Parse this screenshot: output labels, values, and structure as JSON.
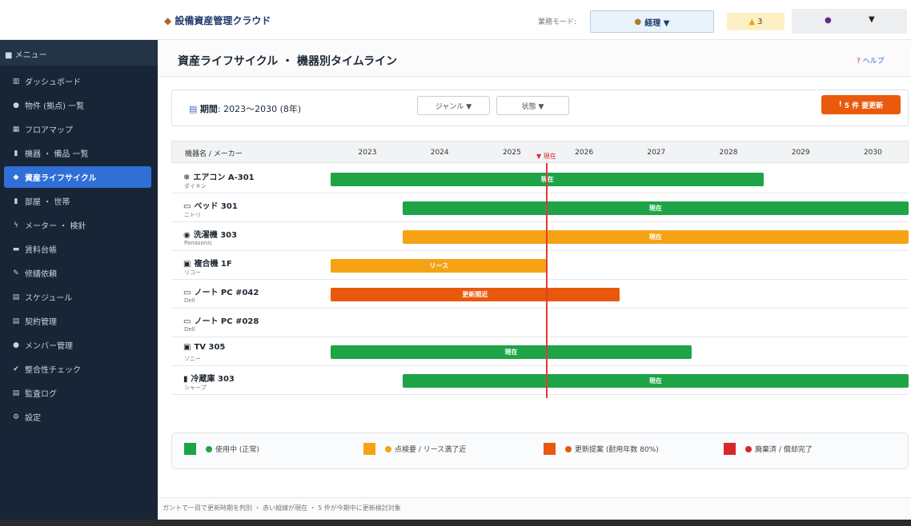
{
  "app": {
    "title": "設備資産管理クラウド",
    "title_icon": "box-icon",
    "mode_label": "業務モード:",
    "mode_value": "経理 ▼",
    "notification_count": "3",
    "user_caret": "▼"
  },
  "sidebar": {
    "header": "メニュー",
    "items": [
      {
        "label": "ダッシュボード",
        "icon": "chart-icon",
        "glyph": "▥"
      },
      {
        "label": "物件 (拠点) 一覧",
        "icon": "pin-icon",
        "glyph": "●"
      },
      {
        "label": "フロアマップ",
        "icon": "map-icon",
        "glyph": "▦"
      },
      {
        "label": "機器 ・ 備品 一覧",
        "icon": "device-icon",
        "glyph": "▮"
      },
      {
        "label": "資産ライフサイクル",
        "icon": "box-icon",
        "glyph": "◆",
        "active": true
      },
      {
        "label": "部屋 ・ 世帯",
        "icon": "door-icon",
        "glyph": "▮"
      },
      {
        "label": "メーター ・ 検針",
        "icon": "bolt-icon",
        "glyph": "ϟ"
      },
      {
        "label": "賃料台帳",
        "icon": "money-icon",
        "glyph": "▬"
      },
      {
        "label": "修繕依頼",
        "icon": "wrench-icon",
        "glyph": "✎"
      },
      {
        "label": "スケジュール",
        "icon": "calendar-icon",
        "glyph": "▤"
      },
      {
        "label": "契約管理",
        "icon": "document-icon",
        "glyph": "▤"
      },
      {
        "label": "メンバー管理",
        "icon": "people-icon",
        "glyph": "●"
      },
      {
        "label": "整合性チェック",
        "icon": "check-icon",
        "glyph": "✔"
      },
      {
        "label": "監査ログ",
        "icon": "clipboard-icon",
        "glyph": "▤"
      },
      {
        "label": "設定",
        "icon": "gear-icon",
        "glyph": "⚙"
      }
    ]
  },
  "page": {
    "title": "資産ライフサイクル ・ 機器別タイムライン",
    "help": "ヘルプ"
  },
  "filters": {
    "period_label": "期間",
    "period_value": ": 2023〜2030 (8年)",
    "genre": "ジャンル ▼",
    "status": "状態 ▼",
    "update_button": "5 件 要更新"
  },
  "colors": {
    "active": "#1ea446",
    "inspection": "#f5a314",
    "replace": "#e8590c",
    "disposed": "#d62828"
  },
  "chart_data": {
    "type": "gantt",
    "col_header": "機器名 / メーカー",
    "years": [
      "2023",
      "2024",
      "2025",
      "2026",
      "2027",
      "2028",
      "2029",
      "2030"
    ],
    "now_label": "▼ 現在",
    "now_year": 2025.5,
    "rows": [
      {
        "name": "エアコン A-301",
        "icon": "snowflake-icon",
        "glyph": "❄",
        "maker": "ダイキン",
        "bar": {
          "start": 2023,
          "end": 2029,
          "label": "現在",
          "status": "active"
        }
      },
      {
        "name": "ベッド 301",
        "icon": "bed-icon",
        "glyph": "▭",
        "maker": "ニトリ",
        "bar": {
          "start": 2024,
          "end": 2031,
          "label": "現在",
          "status": "active"
        }
      },
      {
        "name": "洗濯機 303",
        "icon": "washer-icon",
        "glyph": "◉",
        "maker": "Panasonic",
        "bar": {
          "start": 2024,
          "end": 2031,
          "label": "現在",
          "status": "inspection"
        }
      },
      {
        "name": "複合機 1F",
        "icon": "printer-icon",
        "glyph": "▣",
        "maker": "リコー",
        "bar": {
          "start": 2023,
          "end": 2026,
          "label": "リース",
          "status": "inspection"
        }
      },
      {
        "name": "ノート PC #042",
        "icon": "laptop-icon",
        "glyph": "▭",
        "maker": "Dell",
        "bar": {
          "start": 2023,
          "end": 2027,
          "label": "更新間近",
          "status": "replace"
        }
      },
      {
        "name": "ノート PC #028",
        "icon": "laptop-icon",
        "glyph": "▭",
        "maker": "Dell",
        "bar": null
      },
      {
        "name": "TV 305",
        "icon": "tv-icon",
        "glyph": "▣",
        "maker": "ソニー",
        "bar": {
          "start": 2023,
          "end": 2028,
          "label": "現在",
          "status": "active"
        }
      },
      {
        "name": "冷蔵庫 303",
        "icon": "fridge-icon",
        "glyph": "▮",
        "maker": "シャープ",
        "bar": {
          "start": 2024,
          "end": 2031,
          "label": "現在",
          "status": "active"
        }
      }
    ]
  },
  "legend": [
    {
      "status": "active",
      "label": "使用中 (正常)"
    },
    {
      "status": "inspection",
      "label": "点検要 / リース満了近"
    },
    {
      "status": "replace",
      "label": "更新提案 (耐用年数 80%)"
    },
    {
      "status": "disposed",
      "label": "廃棄済 / 償却完了"
    }
  ],
  "footer": "ガントで一目で更新時期を判別 ・ 赤い縦線が現在 ・ 5 件が今期中に更新検討対象"
}
